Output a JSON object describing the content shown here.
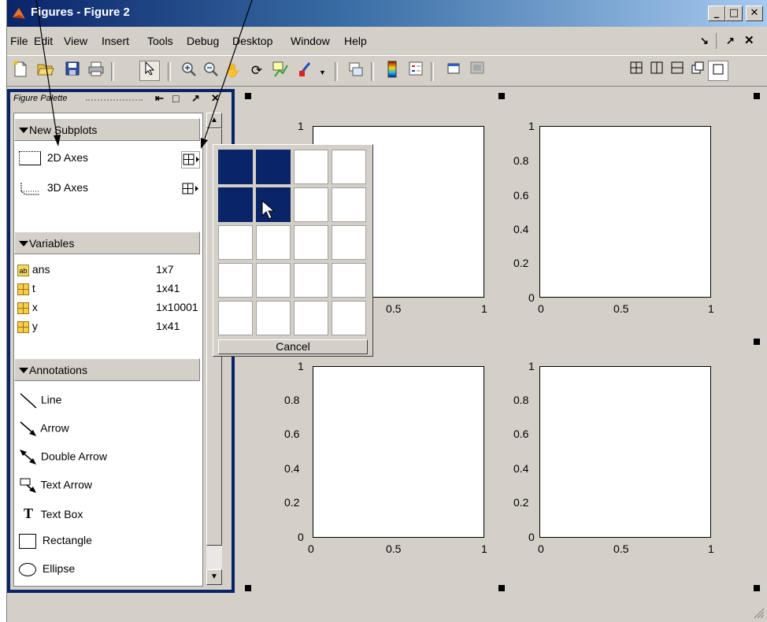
{
  "window": {
    "title": "Figures - Figure 2"
  },
  "menubar": {
    "items": [
      "File",
      "Edit",
      "View",
      "Insert",
      "Tools",
      "Debug",
      "Desktop",
      "Window",
      "Help"
    ],
    "right_icons": [
      "undock",
      "unpin",
      "close"
    ]
  },
  "palette": {
    "title": "Figure Palette",
    "sections": {
      "subplots": {
        "label": "New Subplots",
        "items": [
          {
            "label": "2D Axes",
            "icon": "2d-axes-icon"
          },
          {
            "label": "3D Axes",
            "icon": "3d-axes-icon"
          }
        ]
      },
      "variables": {
        "label": "Variables",
        "items": [
          {
            "name": "ans",
            "size": "1x7",
            "icon": "char-array-icon"
          },
          {
            "name": "t",
            "size": "1x41",
            "icon": "matrix-icon"
          },
          {
            "name": "x",
            "size": "1x10001",
            "icon": "matrix-icon"
          },
          {
            "name": "y",
            "size": "1x41",
            "icon": "matrix-icon"
          }
        ]
      },
      "annotations": {
        "label": "Annotations",
        "items": [
          {
            "label": "Line",
            "icon": "line-icon"
          },
          {
            "label": "Arrow",
            "icon": "arrow-icon"
          },
          {
            "label": "Double Arrow",
            "icon": "double-arrow-icon"
          },
          {
            "label": "Text Arrow",
            "icon": "text-arrow-icon"
          },
          {
            "label": "Text Box",
            "icon": "text-box-icon",
            "glyph": "T"
          },
          {
            "label": "Rectangle",
            "icon": "rectangle-icon"
          },
          {
            "label": "Ellipse",
            "icon": "ellipse-icon"
          }
        ]
      }
    }
  },
  "grid_popup": {
    "rows": 5,
    "cols": 4,
    "selected_rows": 2,
    "selected_cols": 2,
    "cancel_label": "Cancel"
  },
  "axes": {
    "y_ticks_top_right": [
      "1",
      "0.8",
      "0.6",
      "0.4",
      "0.2",
      "0"
    ],
    "y_ticks_bottom": [
      "1",
      "0.8",
      "0.6",
      "0.4",
      "0.2",
      "0"
    ],
    "y_tick_top_left": "1",
    "x_ticks": [
      "0",
      "0.5",
      "1"
    ]
  },
  "colors": {
    "selection": "#0a246a",
    "chrome": "#d4d0c8",
    "titlebar_start": "#0a246a"
  }
}
